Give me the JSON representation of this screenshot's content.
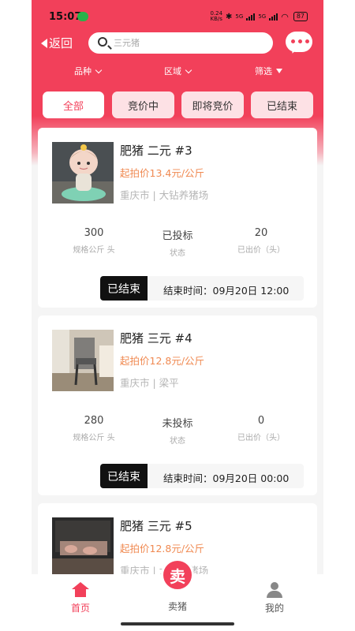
{
  "status_bar": {
    "time": "15:07",
    "network_speed": "0.24\nKB/s",
    "net1": "5G",
    "net2": "5G",
    "battery": "87"
  },
  "nav": {
    "back_label": "返回",
    "search_placeholder": "三元猪"
  },
  "filters": [
    {
      "label": "品种"
    },
    {
      "label": "区域"
    },
    {
      "label": "筛选"
    }
  ],
  "tabs": [
    {
      "label": "全部",
      "active": true
    },
    {
      "label": "竞价中",
      "active": false
    },
    {
      "label": "即将竞价",
      "active": false
    },
    {
      "label": "已结束",
      "active": false
    }
  ],
  "cards": [
    {
      "title": "肥猪 二元 #3",
      "price": "起拍价13.4元/公斤",
      "location": "重庆市 | 大钻养猪场",
      "stats": [
        {
          "value": "300",
          "label": "规格公斤 头"
        },
        {
          "value": "已投标",
          "label": "状态"
        },
        {
          "value": "20",
          "label": "已出价（头）"
        }
      ],
      "badge": "已结束",
      "end_time": "结束时间：09月20日 12:00"
    },
    {
      "title": "肥猪 三元 #4",
      "price": "起拍价12.8元/公斤",
      "location": "重庆市 | 梁平",
      "stats": [
        {
          "value": "280",
          "label": "规格公斤 头"
        },
        {
          "value": "未投标",
          "label": "状态"
        },
        {
          "value": "0",
          "label": "已出价（头）"
        }
      ],
      "badge": "已结束",
      "end_time": "结束时间：09月20日 00:00"
    },
    {
      "title": "肥猪 三元 #5",
      "price": "起拍价12.8元/公斤",
      "location": "重庆市 | 大钻养猪场"
    }
  ],
  "bottom_nav": {
    "home": "首页",
    "sell": "卖猪",
    "sell_glyph": "卖",
    "mine": "我的"
  },
  "colors": {
    "brand": "#f2405a",
    "price": "#f08a52"
  }
}
